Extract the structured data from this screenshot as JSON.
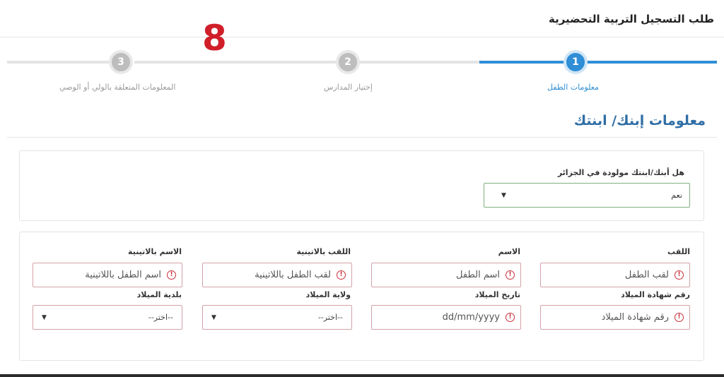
{
  "page": {
    "title": "طلب التسجيل التربية التحضيرية",
    "overlay_number": "8"
  },
  "steps": [
    {
      "number": "1",
      "label": "معلومات الطفل",
      "active": true
    },
    {
      "number": "2",
      "label": "إختيار المدارس",
      "active": false
    },
    {
      "number": "3",
      "label": "المعلومات المتعلقة بالولي أو الوصي",
      "active": false
    }
  ],
  "section": {
    "title": "معلومات إبنك/ ابنتك"
  },
  "born_in_algeria": {
    "label": "هل أبنك/ابنتك مولودة في الجزائر",
    "value": "نعم"
  },
  "fields": {
    "last_name": {
      "label": "اللقب",
      "placeholder": "لقب الطفل"
    },
    "first_name": {
      "label": "الاسم",
      "placeholder": "اسم الطفل"
    },
    "last_name_latin": {
      "label": "اللقب بالاتينية",
      "placeholder": "لقب الطفل باللاتينية"
    },
    "first_name_latin": {
      "label": "الاسم بالاتينية",
      "placeholder": "اسم الطفل باللاتينية"
    },
    "birth_cert_number": {
      "label": "رقم شهادة الميلاد",
      "placeholder": "رقم شهادة الميلاد"
    },
    "birth_date": {
      "label": "تاريخ الميلاد",
      "placeholder": "dd/mm/yyyy"
    },
    "birth_wilaya": {
      "label": "ولاية الميلاد",
      "value": "--اختر--"
    },
    "birth_commune": {
      "label": "بلدية الميلاد",
      "value": "--اختر--"
    }
  },
  "colors": {
    "accent": "#2f8ed6",
    "error": "#c8303b",
    "overlay": "#d01f2a"
  }
}
